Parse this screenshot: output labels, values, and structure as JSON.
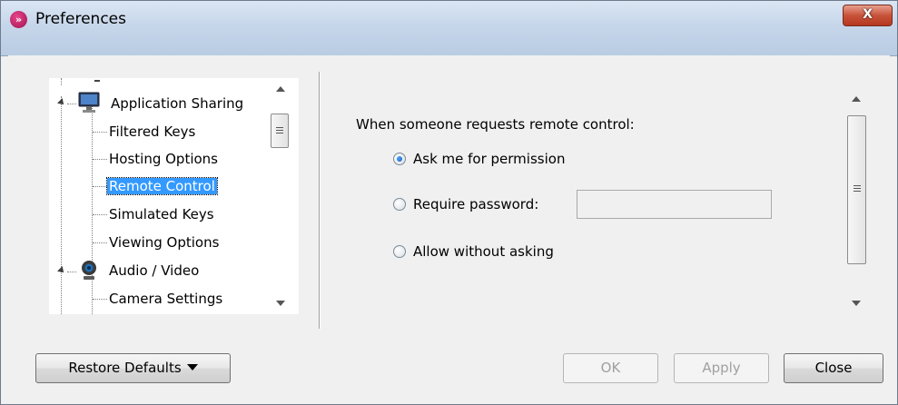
{
  "window": {
    "title": "Preferences",
    "close_glyph": "X"
  },
  "tree": {
    "items": [
      {
        "label": "Application Sharing",
        "icon": "monitor-icon",
        "expanded": true
      },
      {
        "label": "Filtered Keys"
      },
      {
        "label": "Hosting Options"
      },
      {
        "label": "Remote Control",
        "selected": true
      },
      {
        "label": "Simulated Keys"
      },
      {
        "label": "Viewing Options"
      },
      {
        "label": "Audio / Video",
        "icon": "webcam-icon",
        "expanded": true
      },
      {
        "label": "Camera Settings"
      }
    ]
  },
  "remote_control": {
    "prompt": "When someone requests remote control:",
    "options": [
      {
        "label": "Ask me for permission",
        "checked": true
      },
      {
        "label": "Require password:",
        "checked": false
      },
      {
        "label": "Allow without asking",
        "checked": false
      }
    ],
    "password_value": ""
  },
  "buttons": {
    "restore_defaults": "Restore Defaults",
    "ok": "OK",
    "apply": "Apply",
    "close": "Close"
  },
  "colors": {
    "selection": "#3399ff",
    "close_button": "#c8523a"
  }
}
